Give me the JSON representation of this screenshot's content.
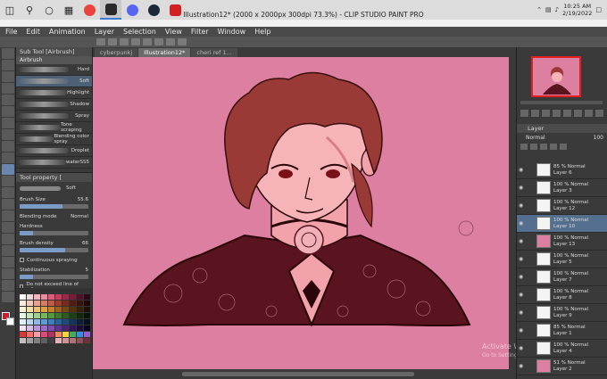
{
  "taskbar": {
    "apps": [
      {
        "name": "chrome",
        "color": "#e8453c"
      },
      {
        "name": "app-2",
        "color": "#2a2a2a"
      },
      {
        "name": "app-3",
        "color": "#5865f2"
      },
      {
        "name": "steam",
        "color": "#1b2838"
      },
      {
        "name": "app-5",
        "color": "#d12020"
      }
    ],
    "time": "10:25 AM",
    "date": "2/19/2022"
  },
  "window": {
    "title": "Illustration12* (2000 x 2000px 300dpi 73.3%)  - CLIP STUDIO PAINT PRO"
  },
  "menu": [
    "File",
    "Edit",
    "Animation",
    "Layer",
    "Selection",
    "View",
    "Filter",
    "Window",
    "Help"
  ],
  "tabs": [
    {
      "label": "cyberpunkj"
    },
    {
      "label": "Illustration12*"
    },
    {
      "label": "cheri ref 1..."
    }
  ],
  "subtool": {
    "title": "Sub Tool [Airbrush]",
    "group": "Airbrush",
    "brushes": [
      {
        "label": "Hard"
      },
      {
        "label": "Soft"
      },
      {
        "label": "Highlight"
      },
      {
        "label": "Shadow"
      },
      {
        "label": "Spray"
      },
      {
        "label": "Tone scraping"
      },
      {
        "label": "Blending color spray"
      },
      {
        "label": "Droplet"
      },
      {
        "label": "waterSS5"
      }
    ]
  },
  "toolprop": {
    "title": "Tool property [",
    "brush_name": "Soft",
    "brush_size_label": "Brush Size",
    "brush_size_value": "55.6",
    "blending_label": "Blending mode",
    "blending_value": "Normal",
    "hardness_label": "Hardness",
    "density_label": "Brush density",
    "density_value": "66",
    "continuous_label": "Continuous spraying",
    "stabilization_label": "Stabilization",
    "stabilization_value": "5",
    "exceed_label": "Do not exceed line of reference"
  },
  "palette": {
    "colors": [
      "#ffffff",
      "#f2d6da",
      "#f6b4c0",
      "#ef8aa0",
      "#e05a7a",
      "#c93a5c",
      "#a02848",
      "#7a1c38",
      "#501228",
      "#2a0a16",
      "#fbe9e2",
      "#f4c8b8",
      "#eaa08a",
      "#db7a64",
      "#c45a46",
      "#a03c2c",
      "#7a2a1e",
      "#561c14",
      "#38120c",
      "#1e0806",
      "#fff2d6",
      "#f6dca4",
      "#eec070",
      "#e0a040",
      "#c88024",
      "#a06018",
      "#7a4810",
      "#563208",
      "#382004",
      "#1e1002",
      "#e8f4e2",
      "#c4e4b8",
      "#9cd08a",
      "#74b85c",
      "#549a3c",
      "#3e7a2a",
      "#2c5c1e",
      "#1e4014",
      "#12280c",
      "#081406",
      "#e2eef8",
      "#b8d6f0",
      "#8cbae4",
      "#609cd4",
      "#3e7ebe",
      "#2c62a0",
      "#1e4a7e",
      "#14345c",
      "#0a203c",
      "#04101e",
      "#efe2f6",
      "#d8bcec",
      "#bc94de",
      "#9c6ccc",
      "#7e4cb4",
      "#603496",
      "#462476",
      "#301656",
      "#1c0c36",
      "#0c041a",
      "#d83a3a",
      "#ff6a6a",
      "#ff9aa8",
      "#e04a7a",
      "#b43060",
      "#f08c5a",
      "#ffd040",
      "#40b060",
      "#3a8ee0",
      "#9a5ad0",
      "#c0c0c0",
      "#a0a0a0",
      "#808080",
      "#606060",
      "#404040",
      "#e8b0b8",
      "#d09098",
      "#b07078",
      "#905058",
      "#703038"
    ]
  },
  "navigator": {},
  "layers": {
    "title": "Layer",
    "blend_mode": "Normal",
    "opacity": "100",
    "items": [
      {
        "opacity": "85 % Normal",
        "name": "Layer 6"
      },
      {
        "opacity": "100 % Normal",
        "name": "Layer 3"
      },
      {
        "opacity": "100 % Normal",
        "name": "Layer 12"
      },
      {
        "opacity": "100 % Normal",
        "name": "Layer 10"
      },
      {
        "opacity": "100 % Normal",
        "name": "Layer 13"
      },
      {
        "opacity": "100 % Normal",
        "name": "Layer 5"
      },
      {
        "opacity": "100 % Normal",
        "name": "Layer 7"
      },
      {
        "opacity": "100 % Normal",
        "name": "Layer 8"
      },
      {
        "opacity": "100 % Normal",
        "name": "Layer 9"
      },
      {
        "opacity": "85 % Normal",
        "name": "Layer 1"
      },
      {
        "opacity": "100 % Normal",
        "name": "Layer 4"
      },
      {
        "opacity": "51 % Normal",
        "name": "Layer 2"
      }
    ]
  },
  "watermark": {
    "line1": "Activate Windows",
    "line2": "Go to Settings to activate Windows."
  }
}
